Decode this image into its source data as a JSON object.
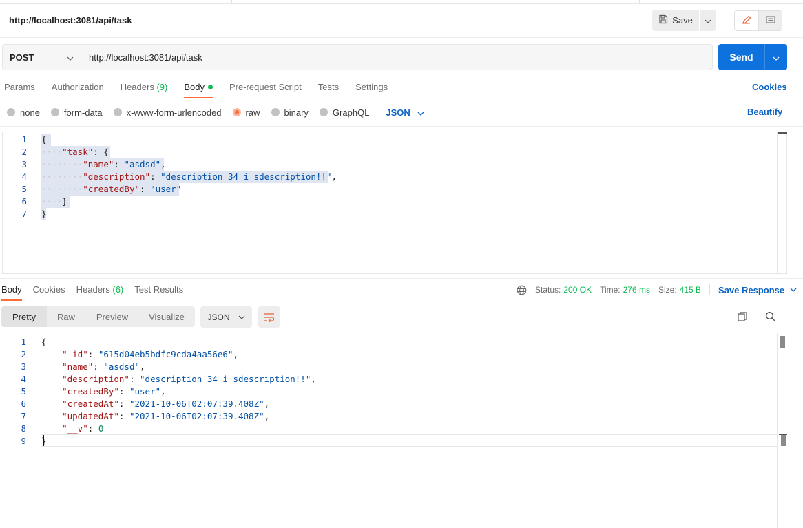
{
  "header": {
    "request_title": "http://localhost:3081/api/task",
    "save_label": "Save"
  },
  "request": {
    "method": "POST",
    "url": "http://localhost:3081/api/task",
    "send_label": "Send"
  },
  "request_tabs": {
    "params": "Params",
    "authorization": "Authorization",
    "headers": "Headers",
    "headers_count": "(9)",
    "body": "Body",
    "prerequest": "Pre-request Script",
    "tests": "Tests",
    "settings": "Settings",
    "cookies": "Cookies"
  },
  "body_types": {
    "none": "none",
    "form_data": "form-data",
    "urlencoded": "x-www-form-urlencoded",
    "raw": "raw",
    "binary": "binary",
    "graphql": "GraphQL",
    "language": "JSON",
    "beautify": "Beautify",
    "selected": "raw"
  },
  "request_body": {
    "line_numbers": [
      "1",
      "2",
      "3",
      "4",
      "5",
      "6",
      "7"
    ],
    "task_key": "\"task\"",
    "name_key": "\"name\"",
    "name_val": "\"asdsd\"",
    "desc_key": "\"description\"",
    "desc_val": "\"description 34 i sdescription!!\"",
    "created_key": "\"createdBy\"",
    "created_val": "\"user\""
  },
  "response_tabs": {
    "body": "Body",
    "cookies": "Cookies",
    "headers": "Headers",
    "headers_count": "(6)",
    "test_results": "Test Results"
  },
  "response_meta": {
    "status_label": "Status:",
    "status_value": "200 OK",
    "time_label": "Time:",
    "time_value": "276 ms",
    "size_label": "Size:",
    "size_value": "415 B",
    "save_response": "Save Response"
  },
  "response_format": {
    "pretty": "Pretty",
    "raw": "Raw",
    "preview": "Preview",
    "visualize": "Visualize",
    "language": "JSON",
    "active": "Pretty"
  },
  "response_body": {
    "line_numbers": [
      "1",
      "2",
      "3",
      "4",
      "5",
      "6",
      "7",
      "8",
      "9"
    ],
    "id_key": "\"_id\"",
    "id_val": "\"615d04eb5bdfc9cda4aa56e6\"",
    "name_key": "\"name\"",
    "name_val": "\"asdsd\"",
    "desc_key": "\"description\"",
    "desc_val": "\"description 34 i sdescription!!\"",
    "created_by_key": "\"createdBy\"",
    "created_by_val": "\"user\"",
    "created_at_key": "\"createdAt\"",
    "created_at_val": "\"2021-10-06T02:07:39.408Z\"",
    "updated_at_key": "\"updatedAt\"",
    "updated_at_val": "\"2021-10-06T02:07:39.408Z\"",
    "v_key": "\"__v\"",
    "v_val": "0"
  },
  "colors": {
    "accent": "#ff6c37",
    "send": "#0e72de",
    "link": "#0b64c2",
    "success": "#0cbb52",
    "json_key": "#a31515",
    "json_string": "#0451a5",
    "json_number": "#098658"
  },
  "icons": [
    "save-icon",
    "chevron-down-icon",
    "pencil-icon",
    "comment-icon",
    "globe-icon",
    "wrap-lines-icon",
    "copy-icon",
    "search-icon"
  ]
}
